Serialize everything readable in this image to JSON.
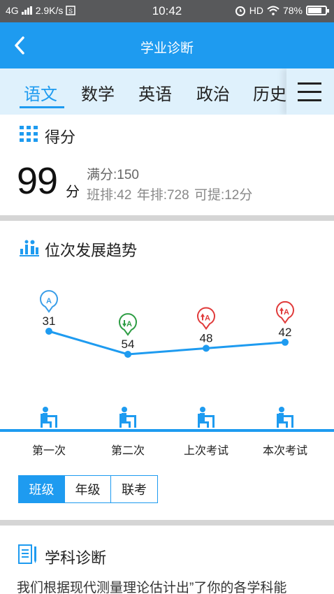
{
  "status_bar": {
    "network": "4G",
    "speed": "2.9K/s",
    "time": "10:42",
    "hd": "HD",
    "battery_percent": "78%",
    "battery_level": 0.78
  },
  "app_bar": {
    "title": "学业诊断"
  },
  "subjects": [
    {
      "label": "语文",
      "active": true
    },
    {
      "label": "数学",
      "active": false
    },
    {
      "label": "英语",
      "active": false
    },
    {
      "label": "政治",
      "active": false
    },
    {
      "label": "历史",
      "active": false
    }
  ],
  "score_section": {
    "title": "得分",
    "score": "99",
    "unit": "分",
    "full_score": "满分:150",
    "ranks": "班排:42  年排:728  可提:12分"
  },
  "trend_section": {
    "title": "位次发展趋势",
    "chart_data": {
      "type": "line",
      "categories": [
        "第一次",
        "第二次",
        "上次考试",
        "本次考试"
      ],
      "values": [
        31,
        54,
        48,
        42
      ],
      "y_inverted": true,
      "line_color": "#1e9bf0",
      "marker_labels": [
        "A",
        "A",
        "A",
        "A"
      ],
      "marker_colors": [
        "#3a9ee8",
        "#2e9d44",
        "#e03a3a",
        "#e03a3a"
      ],
      "marker_trends": [
        "none",
        "down",
        "up",
        "up"
      ]
    },
    "filters": [
      {
        "label": "班级",
        "active": true
      },
      {
        "label": "年级",
        "active": false
      },
      {
        "label": "联考",
        "active": false
      }
    ]
  },
  "diagnosis_section": {
    "title": "学科诊断",
    "text": "我们根据现代测量理论估计出”了你的各学科能"
  },
  "colors": {
    "primary": "#1e9bf0",
    "tab_bg": "#dff1fc",
    "status_bg": "#58595b"
  }
}
